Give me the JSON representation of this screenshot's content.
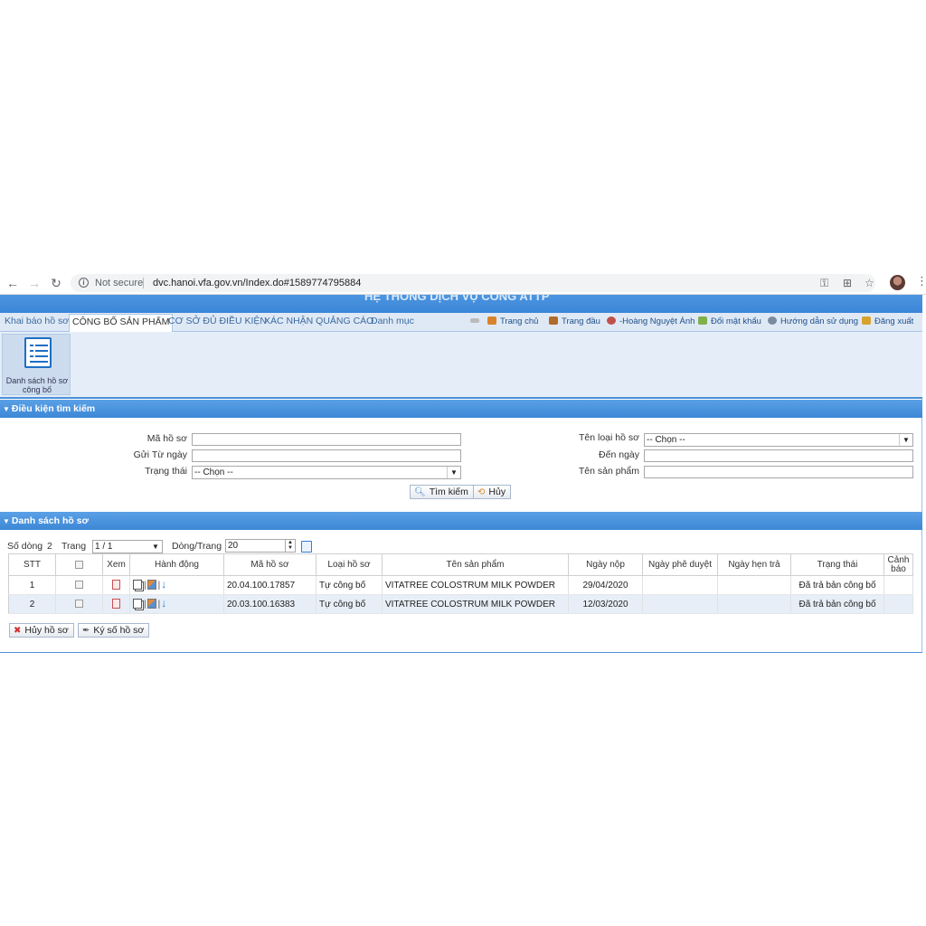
{
  "browser": {
    "not_secure": "Not secure",
    "url": "dvc.hanoi.vfa.gov.vn/Index.do#1589774795884"
  },
  "app": {
    "banner_title": "HỆ THỐNG DỊCH VỤ CÔNG ATTP",
    "tabs": [
      {
        "label": "Khai báo hồ sơ"
      },
      {
        "label": "CÔNG BỐ SẢN PHẨM"
      },
      {
        "label": "CƠ SỞ ĐỦ ĐIỀU KIỆN"
      },
      {
        "label": "XÁC NHẬN QUẢNG CÁO"
      },
      {
        "label": "Danh mục"
      }
    ],
    "links": {
      "home": "Trang chủ",
      "first": "Trang đầu",
      "user": "-Hoàng Nguyệt Ánh",
      "change_password": "Đổi mật khẩu",
      "guide": "Hướng dẫn sử dụng",
      "logout": "Đăng xuất"
    },
    "ribbon_button": "Danh sách hồ sơ công bố",
    "colors": {
      "header_blue": "#3c87d6",
      "alt_row": "#e7eef7"
    }
  },
  "search": {
    "title": "Điều kiện tìm kiếm",
    "ma_ho_so": "Mã hồ sơ",
    "gui_tu_ngay": "Gửi Từ ngày",
    "trang_thai": "Trạng thái",
    "trang_thai_value": "-- Chọn --",
    "ten_loai_ho_so": "Tên loại hồ sơ",
    "ten_loai_value": "-- Chọn --",
    "den_ngay": "Đến ngày",
    "ten_san_pham": "Tên sản phẩm",
    "search_button": "Tìm kiếm",
    "cancel_button": "Hủy"
  },
  "list": {
    "title": "Danh sách hồ sơ",
    "so_dong_label": "Số dòng",
    "so_dong_value": "2",
    "trang_label": "Trang",
    "trang_value": "1 / 1",
    "dong_trang_label": "Dòng/Trang",
    "dong_trang_value": "20",
    "columns": [
      "STT",
      "",
      "Xem",
      "Hành động",
      "Mã hồ sơ",
      "Loại hồ sơ",
      "Tên sản phẩm",
      "Ngày nộp",
      "Ngày phê duyệt",
      "Ngày hẹn trả",
      "Trạng thái",
      "Cảnh báo"
    ],
    "rows": [
      {
        "stt": "1",
        "ma": "20.04.100.17857",
        "loai": "Tự công bố",
        "ten": "VITATREE COLOSTRUM MILK POWDER",
        "ngay_nop": "29/04/2020",
        "ngay_duyet": "",
        "ngay_hen": "",
        "trang_thai": "Đã trả bản công bố",
        "canh_bao": ""
      },
      {
        "stt": "2",
        "ma": "20.03.100.16383",
        "loai": "Tự công bố",
        "ten": "VITATREE COLOSTRUM MILK POWDER",
        "ngay_nop": "12/03/2020",
        "ngay_duyet": "",
        "ngay_hen": "",
        "trang_thai": "Đã trả bản công bố",
        "canh_bao": ""
      }
    ],
    "huy_button": "Hủy hồ sơ",
    "ky_button": "Ký số hồ sơ"
  }
}
